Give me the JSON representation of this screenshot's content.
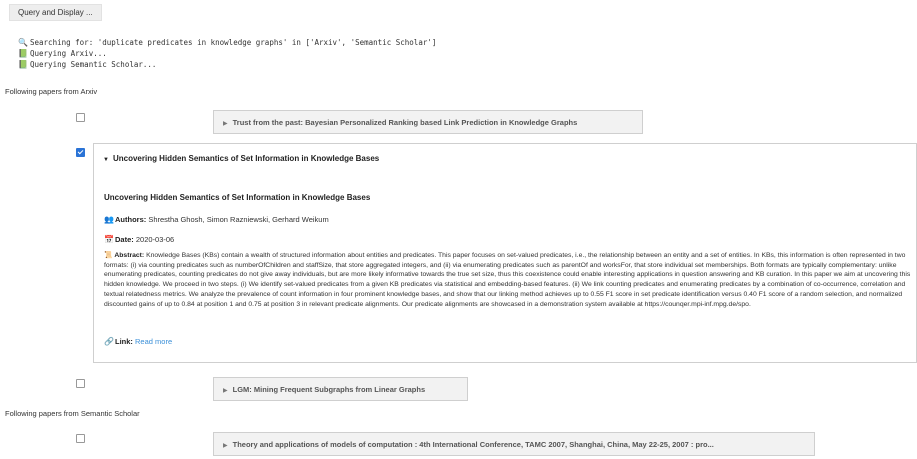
{
  "query_button": "Query and Display ...",
  "log": [
    {
      "icon": "magnifier-icon",
      "glyph": "🔍",
      "text": "Searching for: 'duplicate predicates in knowledge graphs' in ['Arxiv', 'Semantic Scholar']"
    },
    {
      "icon": "book-icon",
      "glyph": "📗",
      "text": "Querying Arxiv..."
    },
    {
      "icon": "book-icon",
      "glyph": "📗",
      "text": "Querying Semantic Scholar..."
    }
  ],
  "sections": {
    "arxiv_label": "Following papers from Arxiv",
    "ss_label": "Following papers from Semantic Scholar"
  },
  "papers": [
    {
      "title": "Trust from the past: Bayesian Personalized Ranking based Link Prediction in Knowledge Graphs",
      "checked": false
    },
    {
      "title": "Uncovering Hidden Semantics of Set Information in Knowledge Bases",
      "checked": true,
      "authors_label": "Authors:",
      "authors": "Shrestha Ghosh, Simon Razniewski, Gerhard Weikum",
      "date_label": "Date:",
      "date": "2020-03-06",
      "abstract_label": "Abstract:",
      "abstract": "Knowledge Bases (KBs) contain a wealth of structured information about entities and predicates. This paper focuses on set-valued predicates, i.e., the relationship between an entity and a set of entities. In KBs, this information is often represented in two formats: (i) via counting predicates such as numberOfChildren and staffSize, that store aggregated integers, and (ii) via enumerating predicates such as parentOf and worksFor, that store individual set memberships. Both formats are typically complementary: unlike enumerating predicates, counting predicates do not give away individuals, but are more likely informative towards the true set size, thus this coexistence could enable interesting applications in question answering and KB curation. In this paper we aim at uncovering this hidden knowledge. We proceed in two steps. (i) We identify set-valued predicates from a given KB predicates via statistical and embedding-based features. (ii) We link counting predicates and enumerating predicates by a combination of co-occurrence, correlation and textual relatedness metrics. We analyze the prevalence of count information in four prominent knowledge bases, and show that our linking method achieves up to 0.55 F1 score in set predicate identification versus 0.40 F1 score of a random selection, and normalized discounted gains of up to 0.84 at position 1 and 0.75 at position 3 in relevant predicate alignments. Our predicate alignments are showcased in a demonstration system available at https://counqer.mpi-inf.mpg.de/spo.",
      "link_label": "Link:",
      "link_text": "Read more"
    },
    {
      "title": "LGM: Mining Frequent Subgraphs from Linear Graphs",
      "checked": false
    },
    {
      "title": "Theory and applications of models of computation : 4th International Conference, TAMC 2007, Shanghai, China, May 22-25, 2007 : pro...",
      "checked": false
    }
  ],
  "colors": {
    "checkbox_checked": "#2a73d6",
    "link": "#3a8fd8",
    "panel_border": "#cfcfcf"
  }
}
